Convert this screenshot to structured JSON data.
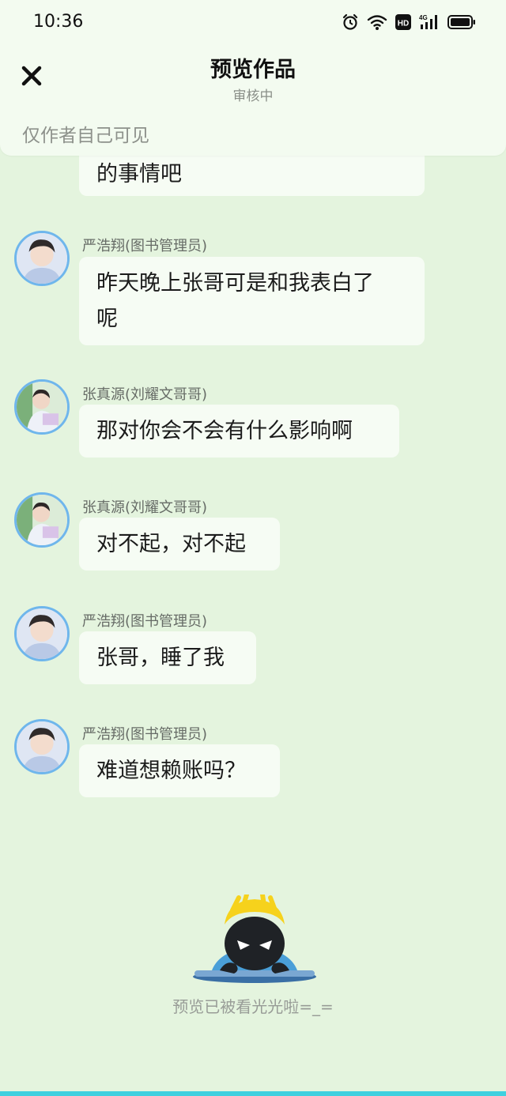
{
  "status_bar": {
    "time": "10:36"
  },
  "header": {
    "title": "预览作品",
    "subtitle": "审核中",
    "visibility_note": "仅作者自己可见"
  },
  "messages": [
    {
      "text": "的事情吧"
    },
    {
      "name": "严浩翔(图书管理员)",
      "text_line1": "昨天晚上张哥可是和我表白了",
      "text_line2": "呢"
    },
    {
      "name": "张真源(刘耀文哥哥)",
      "text": "那对你会不会有什么影响啊"
    },
    {
      "name": "张真源(刘耀文哥哥)",
      "text": "对不起，对不起"
    },
    {
      "name": "严浩翔(图书管理员)",
      "text": "张哥，睡了我"
    },
    {
      "name": "严浩翔(图书管理员)",
      "text": "难道想赖账吗？"
    }
  ],
  "footer": {
    "preview_note": "预览已被看光光啦=_="
  },
  "icons": {
    "close": "close-icon",
    "alarm": "alarm-icon",
    "wifi": "wifi-icon",
    "hd": "hd-icon",
    "signal": "signal-4g-icon",
    "battery": "battery-icon"
  },
  "colors": {
    "background": "#e4f4de",
    "bubble": "#f6fcf4",
    "avatar_ring": "#6fb6ec",
    "bottom_bar": "#3fd0df"
  }
}
